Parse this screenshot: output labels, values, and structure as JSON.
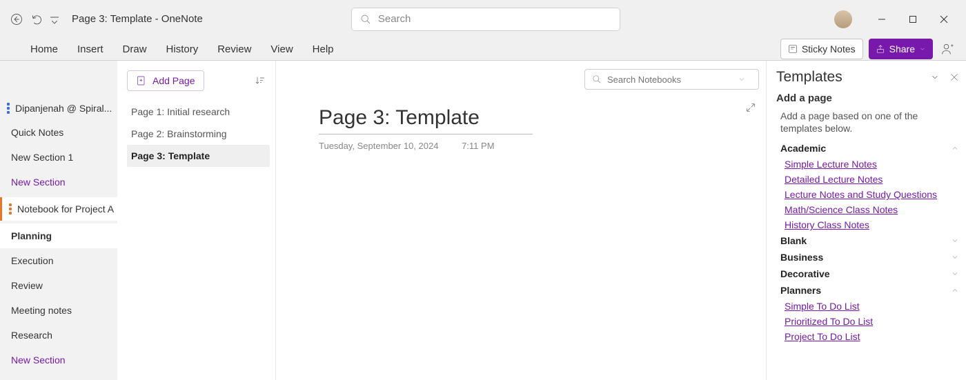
{
  "title": "Page 3: Template  -  OneNote",
  "search_placeholder": "Search",
  "menu": [
    "Home",
    "Insert",
    "Draw",
    "History",
    "Review",
    "View",
    "Help"
  ],
  "sticky_label": "Sticky Notes",
  "share_label": "Share",
  "left": {
    "notebook1": "Dipanjenah @ Spiral...",
    "sections1": [
      "Quick Notes",
      "New Section 1",
      "New Section"
    ],
    "notebook2": "Notebook for Project A",
    "sections2": [
      "Planning",
      "Execution",
      "Review",
      "Meeting notes",
      "Research",
      "New Section"
    ]
  },
  "add_page_label": "Add Page",
  "pages": [
    "Page 1: Initial research",
    "Page 2: Brainstorming",
    "Page 3: Template"
  ],
  "search_notebooks_placeholder": "Search Notebooks",
  "page": {
    "title": "Page 3: Template",
    "date": "Tuesday, September 10, 2024",
    "time": "7:11 PM"
  },
  "templates": {
    "heading": "Templates",
    "add_page": "Add a page",
    "desc": "Add a page based on one of the templates below.",
    "academic": {
      "label": "Academic",
      "links": [
        "Simple Lecture Notes",
        "Detailed Lecture Notes",
        "Lecture Notes and Study Questions",
        "Math/Science Class Notes",
        "History Class Notes"
      ]
    },
    "blank": "Blank",
    "business": "Business",
    "decorative": "Decorative",
    "planners": {
      "label": "Planners",
      "links": [
        "Simple To Do List",
        "Prioritized To Do List",
        "Project To Do List"
      ]
    }
  }
}
